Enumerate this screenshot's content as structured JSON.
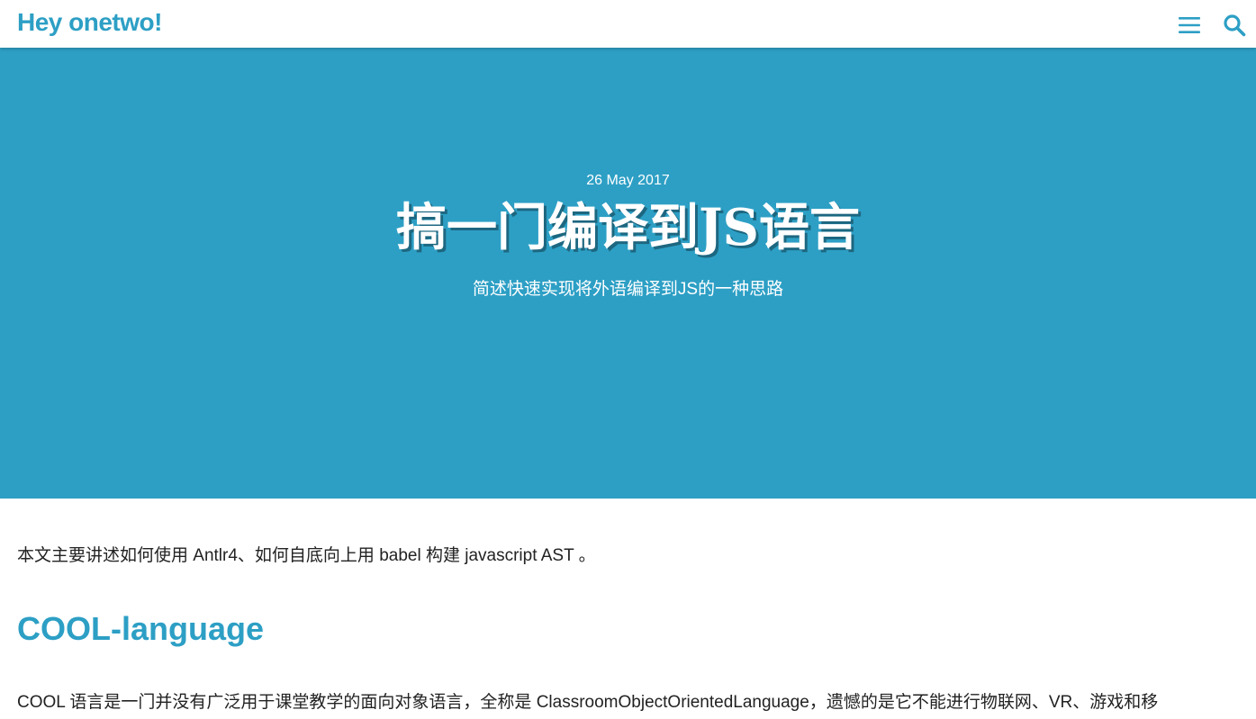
{
  "header": {
    "site_title": "Hey onetwo!",
    "menu_icon": "hamburger-menu-icon",
    "search_icon": "search-icon",
    "accent_color": "#2d9fc5"
  },
  "hero": {
    "date": "26 May 2017",
    "title": "搞一门编译到JS语言",
    "subtitle": "简述快速实现将外语编译到JS的一种思路",
    "background_color": "#2d9fc5"
  },
  "article": {
    "intro": "本文主要讲述如何使用 Antlr4、如何自底向上用 babel 构建 javascript AST 。",
    "section_heading": "COOL-language",
    "paragraph": "COOL 语言是一门并没有广泛用于课堂教学的面向对象语言，全称是 ClassroomObjectOrientedLanguage，遗憾的是它不能进行物联网、VR、游戏和移"
  }
}
